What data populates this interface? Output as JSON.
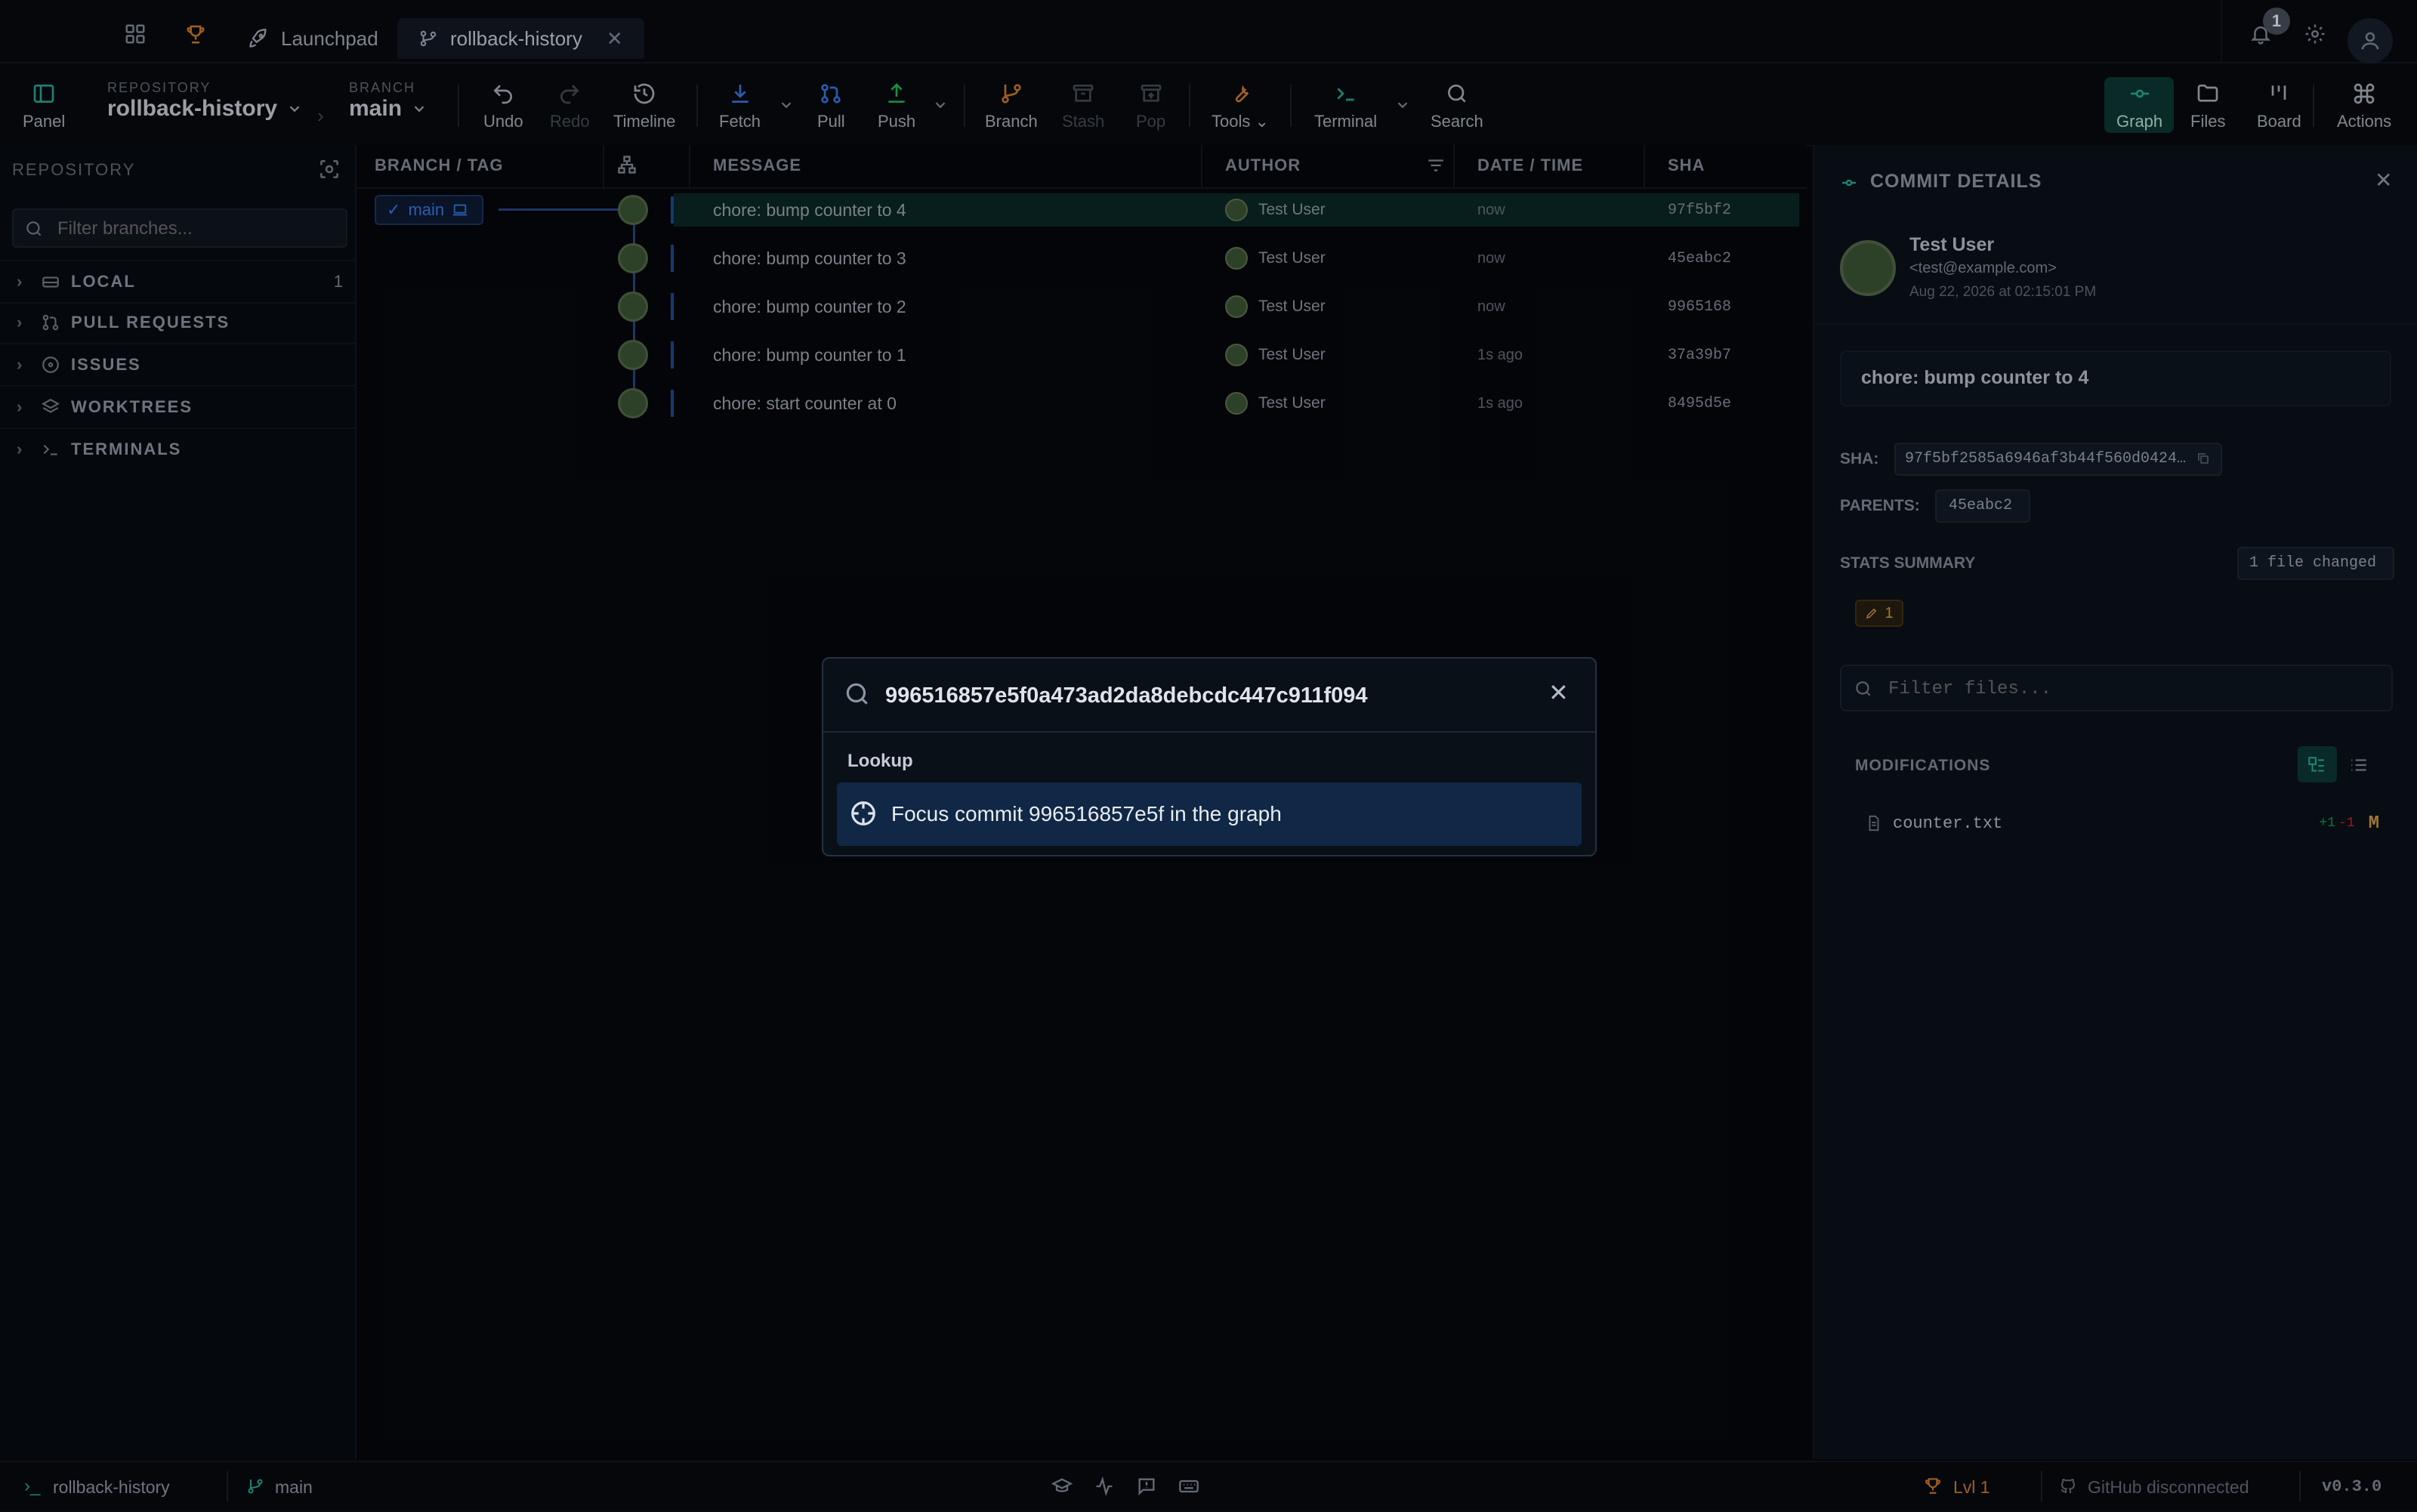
{
  "titlebar": {
    "tabs": [
      {
        "label": "Launchpad",
        "icon": "rocket-icon"
      },
      {
        "label": "rollback-history",
        "icon": "branch-icon",
        "active": true
      }
    ],
    "notification_count": "1"
  },
  "toolbar": {
    "panel_label": "Panel",
    "repository_label": "REPOSITORY",
    "repository_value": "rollback-history",
    "branch_label": "BRANCH",
    "branch_value": "main",
    "undo": "Undo",
    "redo": "Redo",
    "timeline": "Timeline",
    "fetch": "Fetch",
    "pull": "Pull",
    "push": "Push",
    "branch": "Branch",
    "stash": "Stash",
    "pop": "Pop",
    "tools": "Tools",
    "terminal": "Terminal",
    "search": "Search",
    "graph": "Graph",
    "files": "Files",
    "board": "Board",
    "actions": "Actions"
  },
  "sidebar": {
    "title": "REPOSITORY",
    "filter_placeholder": "Filter branches...",
    "sections": [
      {
        "label": "LOCAL",
        "count": "1",
        "icon": "drive-icon"
      },
      {
        "label": "PULL REQUESTS",
        "count": "",
        "icon": "pull-request-icon"
      },
      {
        "label": "ISSUES",
        "count": "",
        "icon": "issue-icon"
      },
      {
        "label": "WORKTREES",
        "count": "",
        "icon": "layers-icon"
      },
      {
        "label": "TERMINALS",
        "count": "",
        "icon": "terminal-icon"
      }
    ]
  },
  "graph": {
    "columns": {
      "branch_tag": "BRANCH / TAG",
      "message": "MESSAGE",
      "author": "AUTHOR",
      "date": "DATE / TIME",
      "sha": "SHA"
    },
    "branch_ref": "main",
    "rows": [
      {
        "message": "chore: bump counter to 4",
        "author": "Test User",
        "date": "now",
        "sha": "97f5bf2",
        "selected": true
      },
      {
        "message": "chore: bump counter to 3",
        "author": "Test User",
        "date": "now",
        "sha": "45eabc2"
      },
      {
        "message": "chore: bump counter to 2",
        "author": "Test User",
        "date": "now",
        "sha": "9965168"
      },
      {
        "message": "chore: bump counter to 1",
        "author": "Test User",
        "date": "1s ago",
        "sha": "37a39b7"
      },
      {
        "message": "chore: start counter at 0",
        "author": "Test User",
        "date": "1s ago",
        "sha": "8495d5e"
      }
    ]
  },
  "details": {
    "title": "COMMIT DETAILS",
    "author_name": "Test User",
    "author_email": "<test@example.com>",
    "author_date": "Aug 22, 2026 at 02:15:01 PM",
    "commit_message": "chore: bump counter to 4",
    "sha_label": "SHA:",
    "sha_value": "97f5bf2585a6946af3b44f560d0424…",
    "parents_label": "PARENTS:",
    "parent_value": "45eabc2",
    "stats_label": "STATS SUMMARY",
    "files_changed": "1 file changed",
    "modified_count": "1",
    "filter_placeholder": "Filter files...",
    "modifications_label": "MODIFICATIONS",
    "file_name": "counter.txt",
    "file_additions": "+1",
    "file_deletions": "-1",
    "file_status": "M"
  },
  "modal": {
    "query": "996516857e5f0a473ad2da8debcdc447c911f094",
    "section": "Lookup",
    "result": "Focus commit 996516857e5f in the graph"
  },
  "statusbar": {
    "repo": "rollback-history",
    "branch": "main",
    "level": "Lvl 1",
    "github": "GitHub disconnected",
    "version": "v0.3.0"
  },
  "colors": {
    "accent_teal": "#2bb3a0",
    "accent_blue": "#3b82f6",
    "accent_orange": "#e0822e",
    "selection": "#0f2a45"
  }
}
